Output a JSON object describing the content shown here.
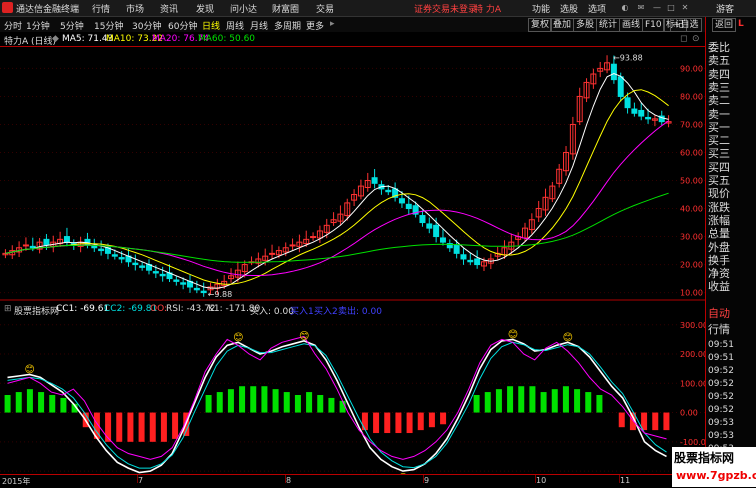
{
  "menubar": {
    "app_title": "通达信金融终端",
    "items": [
      "行情",
      "市场",
      "资讯",
      "发现",
      "问小达",
      "财富圈",
      "交易"
    ],
    "login_status": "证券交易未登录",
    "stock_name": "特 力A",
    "right_items": [
      "功能",
      "选股",
      "选项"
    ],
    "guest": "游客"
  },
  "periodbar": {
    "periods": [
      "分时",
      "1分钟",
      "5分钟",
      "15分钟",
      "30分钟",
      "60分钟",
      "日线",
      "周线",
      "月线",
      "多周期",
      "更多"
    ],
    "active": "日线",
    "tools": [
      "复权",
      "叠加",
      "多股",
      "统计",
      "画线",
      "F10",
      "标记",
      "+自选",
      "返回"
    ]
  },
  "ma_line": {
    "label": "特力A (日线)",
    "ma5": "MA5: 71.43",
    "ma10": "MA10: 73.22",
    "ma20": "MA20: 76.74",
    "ma60": "MA60: 50.60"
  },
  "indicator_line": {
    "name": "股票指标网",
    "cc1": "CC1: -69.61",
    "cc2": "CC2: -69.81",
    "oo": "OO:",
    "rsi": "RSI: -43.72",
    "k1": "K1: -171.80",
    "buy": "买入: 0.00",
    "b1": "买入1",
    "b2": "买入2",
    "sell": "卖出: 0.00"
  },
  "colors": {
    "up": "#ff3232",
    "down": "#00e0e0",
    "ma5": "#ffffff",
    "ma10": "#ffff00",
    "ma20": "#ff00ff",
    "ma60": "#00e000",
    "accent_red": "#b00000"
  },
  "right_panel": {
    "header": "L",
    "labels": [
      "委比",
      "卖五",
      "卖四",
      "卖三",
      "卖二",
      "卖一",
      "买一",
      "买二",
      "买三",
      "买四",
      "买五",
      "现价",
      "涨跌",
      "涨幅",
      "总量",
      "外盘",
      "换手",
      "净资",
      "收益"
    ],
    "auto_label": "自动",
    "quote_label": "行情",
    "ticks": [
      "09:51",
      "09:51",
      "09:52",
      "09:52",
      "09:52",
      "09:52",
      "09:53",
      "09:53",
      "09:53",
      "09:53"
    ]
  },
  "date_axis": [
    "2015年",
    "7",
    "8",
    "9",
    "10",
    "11"
  ],
  "watermark": {
    "name": "股票指标网",
    "url": "www.7gpzb.com"
  },
  "chart_data": [
    {
      "type": "candlestick",
      "name": "daily-kline",
      "ylim": [
        7,
        98
      ],
      "yticks": [
        10.0,
        20.0,
        30.0,
        40.0,
        50.0,
        60.0,
        70.0,
        80.0,
        90.0
      ],
      "annotations": [
        {
          "text": "93.88"
        },
        {
          "text": "9.88"
        }
      ],
      "close": [
        24,
        25,
        26,
        27,
        26,
        28,
        27,
        28,
        29,
        28,
        27,
        28,
        27,
        26,
        25,
        24,
        23,
        22,
        21,
        20,
        19,
        18,
        17,
        16,
        15,
        14,
        13,
        12,
        11,
        10,
        12,
        13,
        14,
        16,
        18,
        20,
        21,
        22,
        23,
        24,
        25,
        26,
        27,
        28,
        29,
        30,
        32,
        34,
        36,
        38,
        42,
        45,
        48,
        50,
        49,
        47,
        46,
        44,
        42,
        40,
        38,
        35,
        33,
        30,
        28,
        26,
        24,
        22,
        21,
        20,
        21,
        22,
        24,
        26,
        28,
        30,
        33,
        36,
        40,
        44,
        48,
        54,
        60,
        70,
        80,
        85,
        88,
        90,
        92,
        86,
        80,
        76,
        74,
        73,
        72,
        72,
        71,
        71
      ]
    },
    {
      "type": "line",
      "name": "indicator",
      "ylim": [
        -210,
        330
      ],
      "yticks": [
        300.0,
        200.0,
        100.0,
        0.0,
        -100.0,
        -200.0
      ],
      "series": [
        {
          "name": "CC1",
          "values": [
            120,
            125,
            130,
            120,
            95,
            70,
            30,
            -20,
            -80,
            -130,
            -170,
            -190,
            -205,
            -200,
            -180,
            -140,
            -60,
            30,
            120,
            190,
            230,
            240,
            220,
            200,
            210,
            225,
            235,
            245,
            230,
            180,
            110,
            30,
            -50,
            -120,
            -160,
            -185,
            -200,
            -195,
            -175,
            -140,
            -90,
            -20,
            60,
            150,
            215,
            245,
            250,
            235,
            210,
            215,
            230,
            240,
            225,
            190,
            140,
            90,
            50,
            -20,
            -100,
            -130,
            -150
          ]
        },
        {
          "name": "CC2",
          "values": [
            110,
            115,
            120,
            115,
            100,
            80,
            50,
            0,
            -60,
            -110,
            -150,
            -175,
            -190,
            -190,
            -175,
            -145,
            -85,
            0,
            80,
            160,
            210,
            230,
            220,
            205,
            205,
            215,
            225,
            235,
            228,
            195,
            130,
            55,
            -20,
            -90,
            -135,
            -165,
            -185,
            -188,
            -175,
            -150,
            -105,
            -40,
            30,
            115,
            185,
            225,
            240,
            232,
            215,
            212,
            222,
            232,
            225,
            200,
            155,
            105,
            65,
            0,
            -70,
            -110,
            -135
          ]
        },
        {
          "name": "K1",
          "values": [
            100,
            110,
            120,
            100,
            70,
            60,
            80,
            40,
            -30,
            -80,
            -120,
            -140,
            -150,
            -160,
            -150,
            -120,
            -50,
            40,
            140,
            200,
            250,
            230,
            200,
            180,
            220,
            240,
            250,
            260,
            200,
            150,
            80,
            0,
            -60,
            -100,
            -130,
            -150,
            -160,
            -150,
            -130,
            -100,
            -60,
            0,
            80,
            170,
            230,
            250,
            240,
            200,
            180,
            220,
            240,
            210,
            170,
            120,
            80,
            60,
            20,
            -30,
            -70,
            -80,
            -90
          ]
        }
      ],
      "bars": [
        60,
        70,
        80,
        70,
        60,
        50,
        30,
        -50,
        -90,
        -100,
        -100,
        -100,
        -100,
        -100,
        -100,
        -90,
        -80,
        0,
        60,
        70,
        80,
        90,
        90,
        90,
        80,
        70,
        60,
        70,
        60,
        50,
        40,
        0,
        -60,
        -70,
        -70,
        -70,
        -70,
        -60,
        -50,
        -40,
        0,
        0,
        60,
        70,
        80,
        90,
        90,
        90,
        70,
        80,
        90,
        80,
        70,
        60,
        0,
        -50,
        -60,
        -60,
        -60,
        -60
      ],
      "signals": [
        {
          "text": "😊"
        }
      ]
    }
  ]
}
